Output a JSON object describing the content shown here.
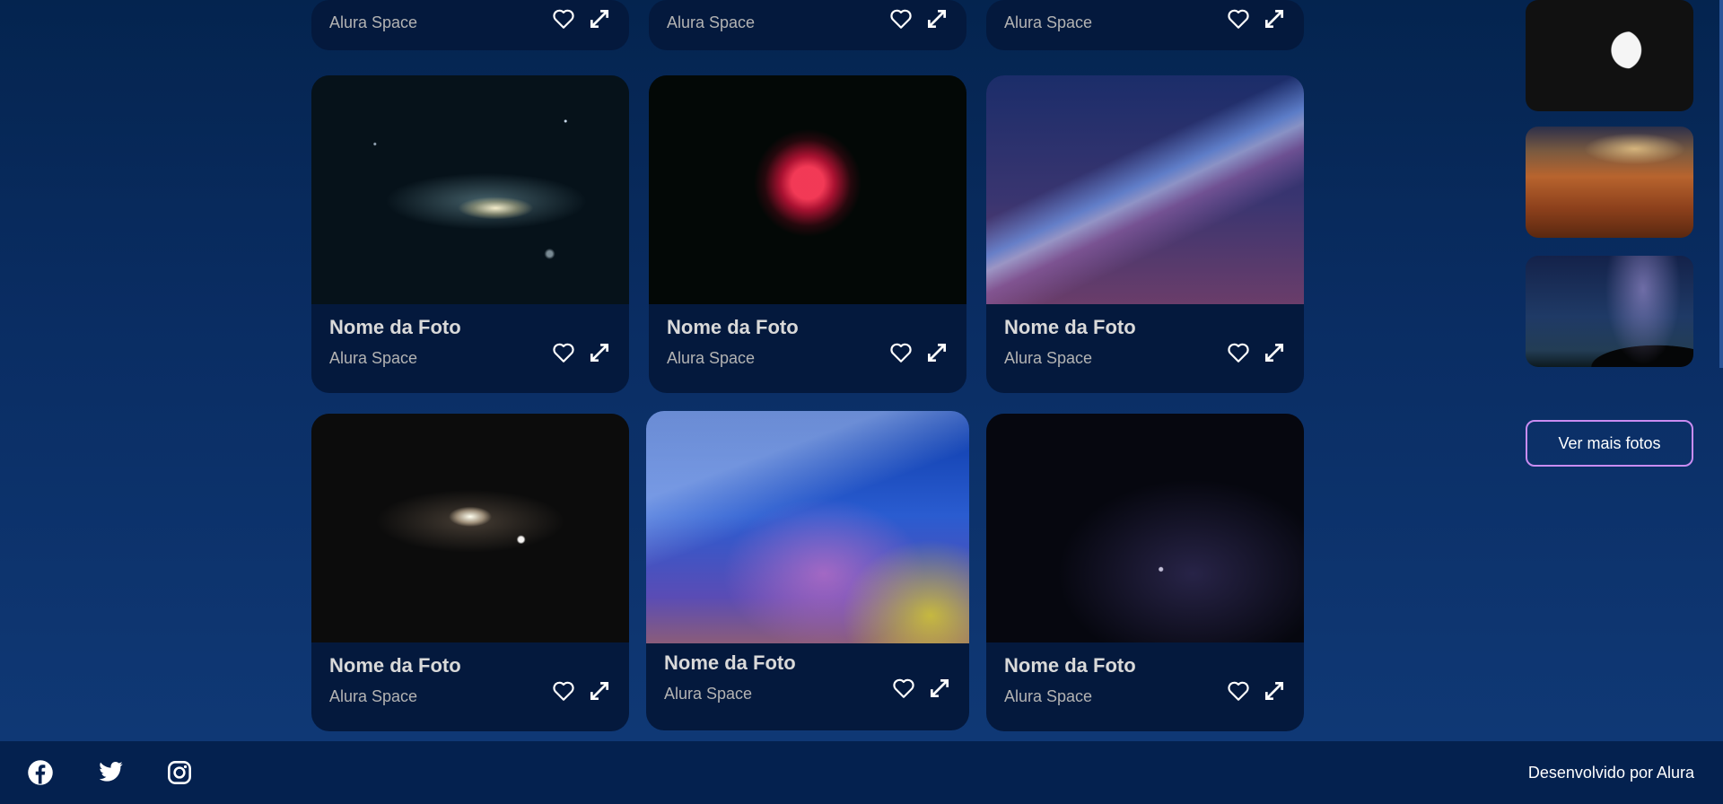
{
  "gallery": {
    "top_cards": [
      {
        "subtitle": "Alura Space"
      },
      {
        "subtitle": "Alura Space"
      },
      {
        "subtitle": "Alura Space"
      }
    ],
    "cards": [
      {
        "title": "Nome da Foto",
        "subtitle": "Alura Space",
        "photo": "andromeda-galaxy"
      },
      {
        "title": "Nome da Foto",
        "subtitle": "Alura Space",
        "photo": "rosette-nebula"
      },
      {
        "title": "Nome da Foto",
        "subtitle": "Alura Space",
        "photo": "milky-way"
      },
      {
        "title": "Nome da Foto",
        "subtitle": "Alura Space",
        "photo": "andromeda-galaxy-2"
      },
      {
        "title": "Nome da Foto",
        "subtitle": "Alura Space",
        "photo": "blue-starfield"
      },
      {
        "title": "Nome da Foto",
        "subtitle": "Alura Space",
        "photo": "dark-starfield"
      }
    ],
    "icons": {
      "favorite": "heart-icon",
      "expand": "expand-icon"
    }
  },
  "sidebar": {
    "thumbnails": [
      "crescent-moon",
      "desert-dunes",
      "night-sky-trees"
    ],
    "more_button_label": "Ver mais fotos",
    "accent_color": "#c98cf1"
  },
  "footer": {
    "social_icons": [
      "facebook-icon",
      "twitter-icon",
      "instagram-icon"
    ],
    "credit": "Desenvolvido por Alura"
  }
}
